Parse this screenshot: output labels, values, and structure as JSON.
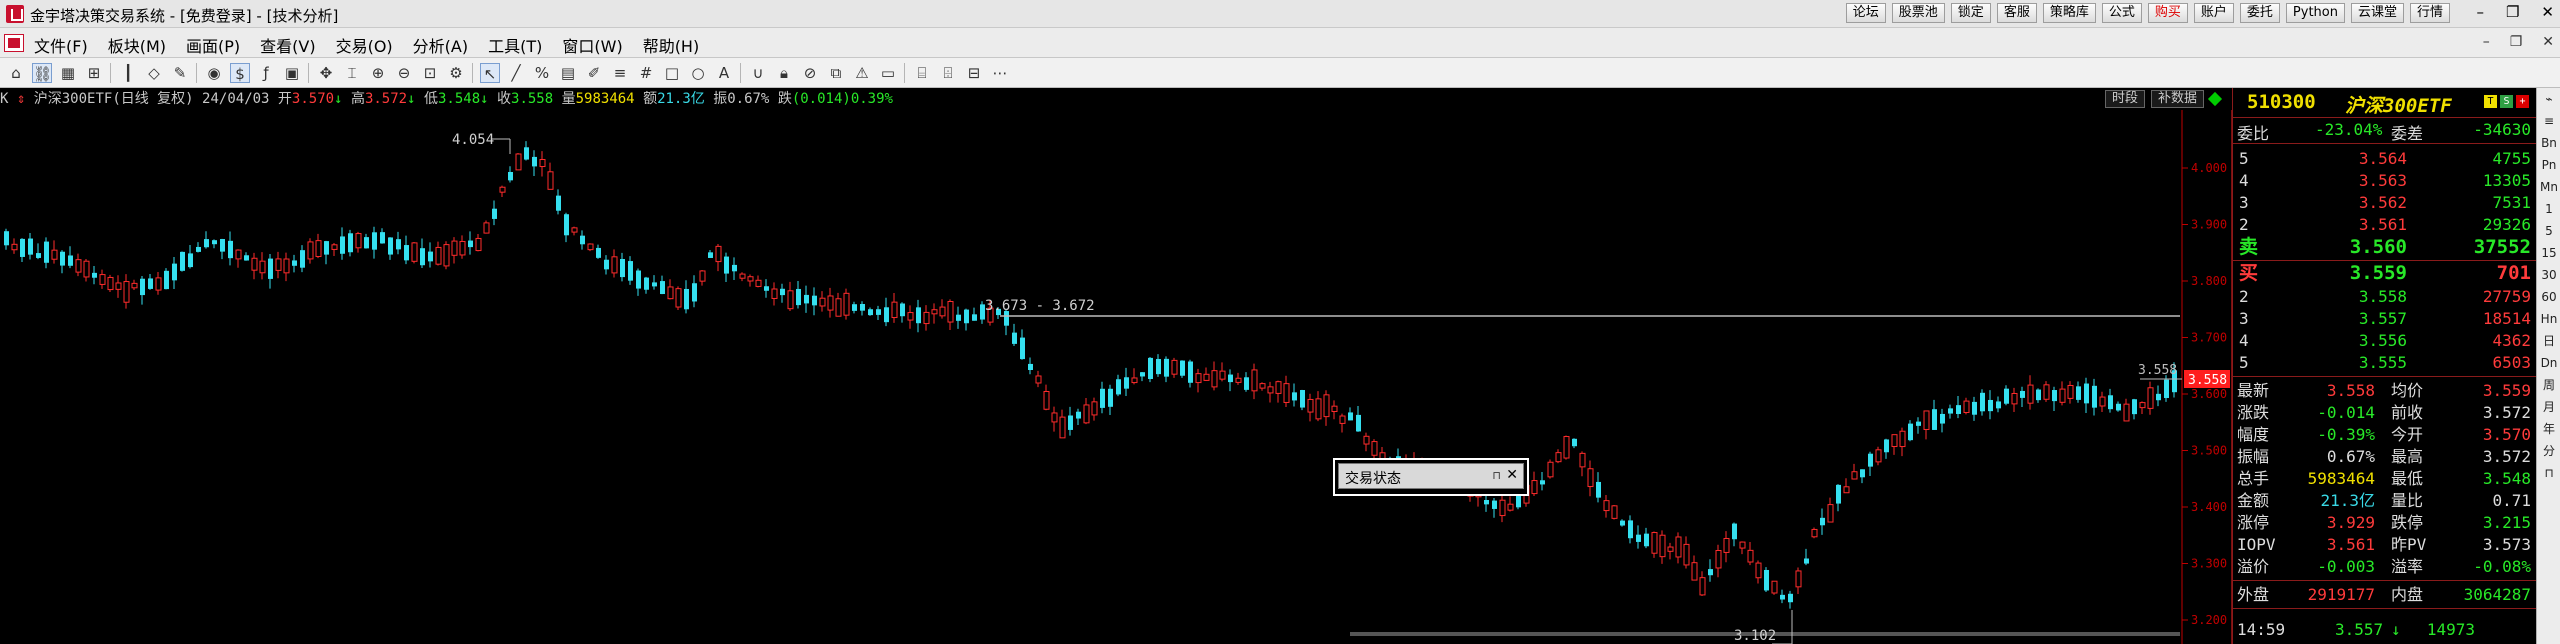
{
  "window": {
    "title": "金宇塔决策交易系统 - [免费登录] - [技术分析]",
    "buttons": [
      "论坛",
      "股票池",
      "锁定",
      "客服",
      "策略库",
      "公式",
      "购买",
      "账户",
      "委托",
      "Python",
      "云课堂",
      "行情"
    ],
    "controls": [
      "–",
      "❐",
      "✕"
    ]
  },
  "menu": {
    "items": [
      "文件(F)",
      "板块(M)",
      "画面(P)",
      "查看(V)",
      "交易(O)",
      "分析(A)",
      "工具(T)",
      "窗口(W)",
      "帮助(H)"
    ],
    "right": [
      "–",
      "❐",
      "✕"
    ]
  },
  "toolbar": {
    "icons": [
      "home-icon",
      "pointer-link-icon",
      "grid-icon",
      "apps-icon",
      "candle-icon",
      "diamond-icon",
      "pen-icon",
      "circle-icon",
      "dollar-icon",
      "formula-icon",
      "box-icon",
      "move-icon",
      "cross-icon",
      "zoom-in-icon",
      "zoom-out-icon",
      "settings-icon",
      "cursor-icon",
      "line-icon",
      "percent-icon",
      "table-icon",
      "draw-icon",
      "parallel-icon",
      "grid-lines-icon",
      "rect-icon",
      "ellipse-icon",
      "text-icon",
      "magnet-icon",
      "lock-icon",
      "delete-icon",
      "copy-icon",
      "alert-icon",
      "save-icon",
      "frame-icon",
      "split-icon",
      "layout-icon"
    ]
  },
  "info_bar": {
    "prefix": "K",
    "name": "沪深300ETF(日线 复权)",
    "date": "24/04/03",
    "open_label": "开",
    "open": "3.570",
    "high_label": "高",
    "high": "3.572",
    "low_label": "低",
    "low": "3.548",
    "close_label": "收",
    "close": "3.558",
    "vol_label": "量",
    "vol": "5983464",
    "amt_label": "额",
    "amt": "21.3亿",
    "amp_label": "振",
    "amp": "0.67%",
    "chg_label": "跌",
    "chg": "(0.014)0.39%",
    "btn_period": "时段",
    "btn_fill": "补数据"
  },
  "chart": {
    "annotations": {
      "high_label": "4.054",
      "low_label": "3.102",
      "range_label": "3.673 - 3.672",
      "current_label": "3.558",
      "current_left_label": "3.558"
    },
    "y_ticks": [
      "4.000",
      "3.900",
      "3.800",
      "3.700",
      "3.600",
      "3.500",
      "3.400",
      "3.300",
      "3.200"
    ],
    "colors": {
      "up": "#ff2b2b",
      "down": "#35e0f0",
      "axis": "#c00000",
      "ma": "#9a9a9a"
    }
  },
  "popup": {
    "title": "交易状态",
    "pin": "⊓",
    "close": "✕"
  },
  "quote": {
    "code": "510300",
    "name": "沪深300ETF",
    "weibi_label": "委比",
    "weibi": "-23.04%",
    "weicha_label": "委差",
    "weicha": "-34630",
    "asks": [
      {
        "level": "5",
        "price": "3.564",
        "vol": "4755"
      },
      {
        "level": "4",
        "price": "3.563",
        "vol": "13305"
      },
      {
        "level": "3",
        "price": "3.562",
        "vol": "7531"
      },
      {
        "level": "2",
        "price": "3.561",
        "vol": "29326"
      },
      {
        "level": "卖",
        "price": "3.560",
        "vol": "37552"
      }
    ],
    "bids": [
      {
        "level": "买",
        "price": "3.559",
        "vol": "701"
      },
      {
        "level": "2",
        "price": "3.558",
        "vol": "27759"
      },
      {
        "level": "3",
        "price": "3.557",
        "vol": "18514"
      },
      {
        "level": "4",
        "price": "3.556",
        "vol": "4362"
      },
      {
        "level": "5",
        "price": "3.555",
        "vol": "6503"
      }
    ],
    "details": [
      {
        "l1": "最新",
        "v1": "3.558",
        "c1": "#ff3b3b",
        "l2": "均价",
        "v2": "3.559",
        "c2": "#ff3b3b"
      },
      {
        "l1": "涨跌",
        "v1": "-0.014",
        "c1": "#28e828",
        "l2": "前收",
        "v2": "3.572",
        "c2": "#ddd"
      },
      {
        "l1": "幅度",
        "v1": "-0.39%",
        "c1": "#28e828",
        "l2": "今开",
        "v2": "3.570",
        "c2": "#ff3b3b"
      },
      {
        "l1": "振幅",
        "v1": "0.67%",
        "c1": "#ddd",
        "l2": "最高",
        "v2": "3.572",
        "c2": "#ddd"
      },
      {
        "l1": "总手",
        "v1": "5983464",
        "c1": "#f0e000",
        "l2": "最低",
        "v2": "3.548",
        "c2": "#28e828"
      },
      {
        "l1": "金额",
        "v1": "21.3亿",
        "c1": "#39d9e6",
        "l2": "量比",
        "v2": "0.71",
        "c2": "#ddd"
      },
      {
        "l1": "涨停",
        "v1": "3.929",
        "c1": "#ff3b3b",
        "l2": "跌停",
        "v2": "3.215",
        "c2": "#28e828"
      },
      {
        "l1": "IOPV",
        "v1": "3.561",
        "c1": "#ff3b3b",
        "l2": "昨PV",
        "v2": "3.573",
        "c2": "#ddd"
      },
      {
        "l1": "溢价",
        "v1": "-0.003",
        "c1": "#28e828",
        "l2": "溢率",
        "v2": "-0.08%",
        "c2": "#28e828"
      }
    ],
    "outer_label": "外盘",
    "outer": "2919177",
    "inner_label": "内盘",
    "inner": "3064287",
    "tick": {
      "time": "14:59",
      "price": "3.557",
      "arrow": "↓",
      "vol": "14973"
    }
  },
  "sidebar": [
    "⌁",
    "≡",
    "Bn",
    "Pn",
    "Mn",
    "1",
    "5",
    "15",
    "30",
    "60",
    "Hn",
    "日",
    "Dn",
    "周",
    "月",
    "年",
    "分",
    "⊓"
  ]
}
